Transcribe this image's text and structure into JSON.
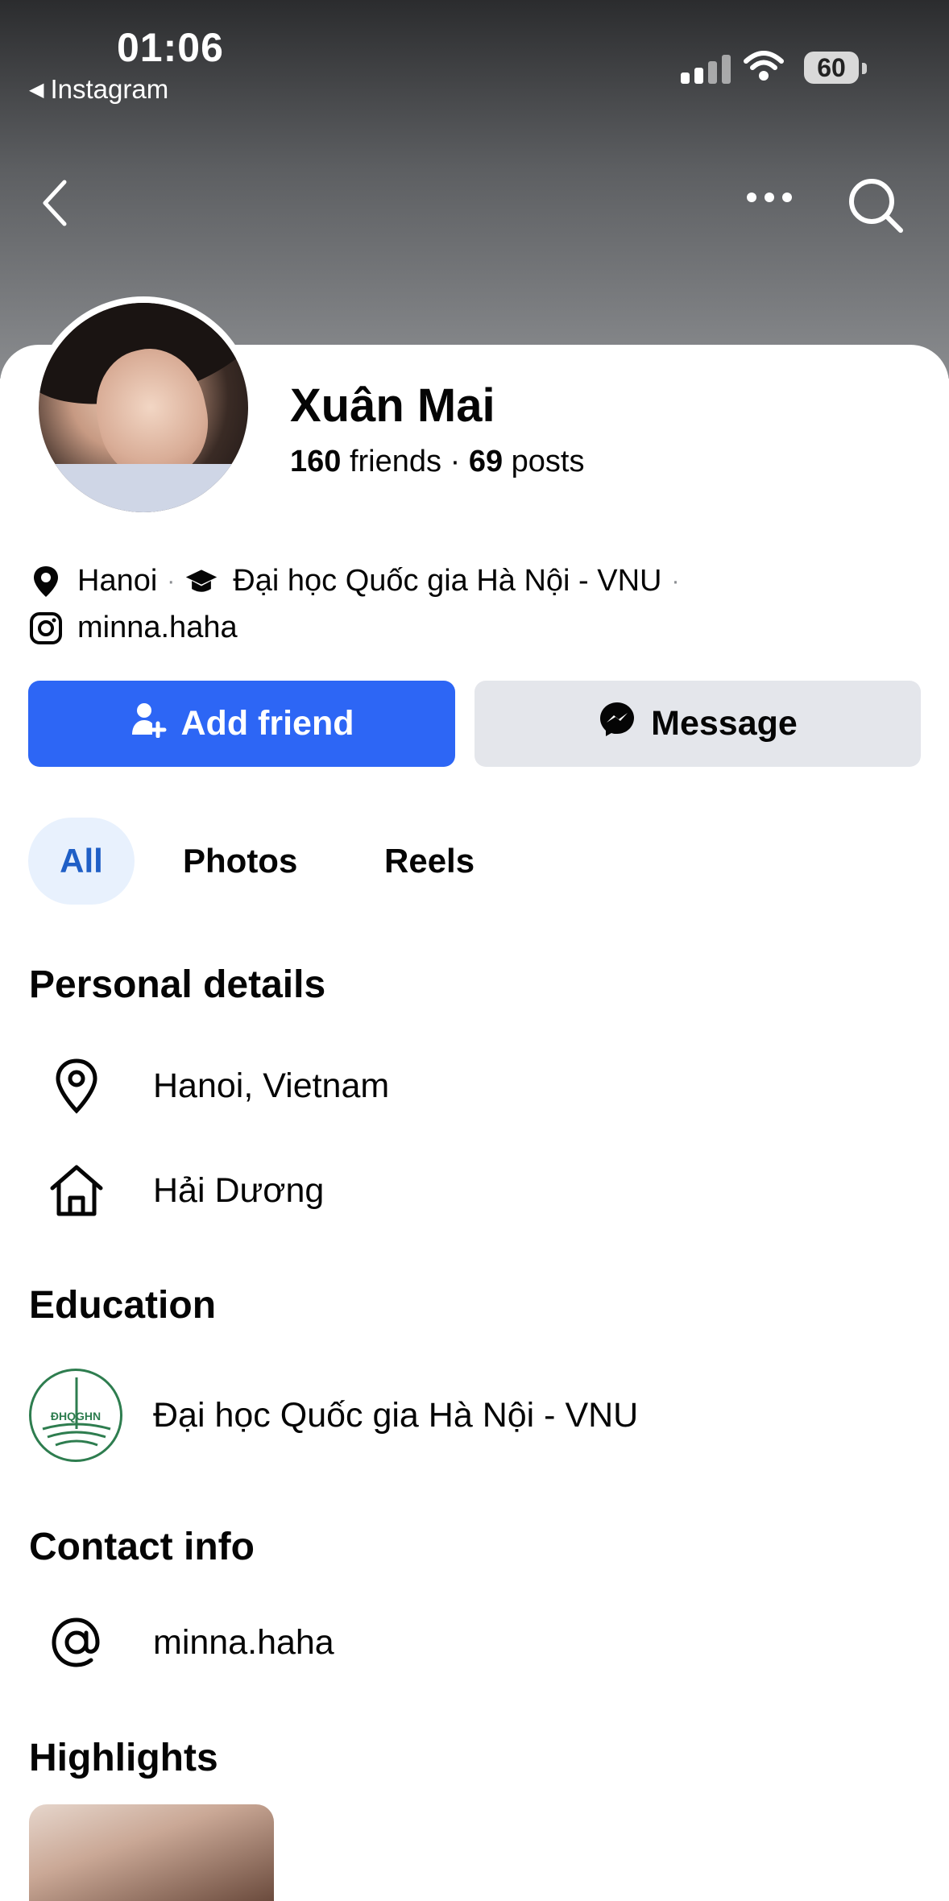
{
  "status_bar": {
    "time": "01:06",
    "back_app": "Instagram",
    "battery": "60"
  },
  "profile": {
    "name": "Xuân Mai",
    "friends_count": "160",
    "friends_label": "friends",
    "separator": "·",
    "posts_count": "69",
    "posts_label": "posts"
  },
  "intro": {
    "city": "Hanoi",
    "school": "Đại học Quốc gia Hà Nội - VNU",
    "instagram": "minna.haha"
  },
  "actions": {
    "add_friend": "Add friend",
    "message": "Message"
  },
  "tabs": [
    {
      "label": "All",
      "active": true
    },
    {
      "label": "Photos",
      "active": false
    },
    {
      "label": "Reels",
      "active": false
    }
  ],
  "personal_details": {
    "title": "Personal details",
    "location": "Hanoi, Vietnam",
    "hometown": "Hải Dương"
  },
  "education": {
    "title": "Education",
    "school": "Đại học Quốc gia Hà Nội - VNU",
    "logo_text": "ĐHQGHN"
  },
  "contact": {
    "title": "Contact info",
    "instagram": "minna.haha"
  },
  "highlights": {
    "title": "Highlights"
  },
  "colors": {
    "primary": "#2d66f5",
    "tab_active_bg": "#e8f1fd",
    "tab_active_text": "#1f5fc6",
    "secondary_button": "#e4e6eb",
    "vnu_green": "#2e7d4f"
  }
}
